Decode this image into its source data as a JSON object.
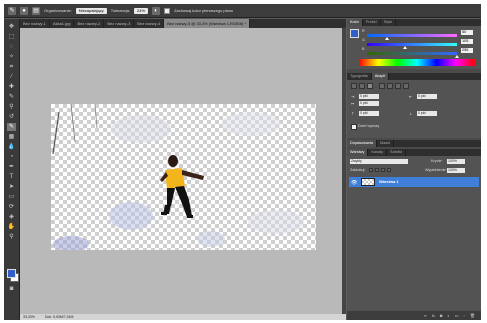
{
  "options": {
    "sample_label": "Organizowanie:",
    "sample_value": "Niezapalający",
    "tolerance_label": "Tolerancja:",
    "tolerance_value": "24%",
    "protect_label": "Zachowaj kolor pierwszego planu"
  },
  "tabs": [
    {
      "label": "Bez nazwy-1"
    },
    {
      "label": "Akka1.jpg"
    },
    {
      "label": "Bez nazwy-2"
    },
    {
      "label": "Bez nazwy-3"
    },
    {
      "label": "Bez nazwy-4"
    },
    {
      "label": "Bez nazwy-5 @ 33,3% (Warstwa 1,RGB/8) *"
    }
  ],
  "status": {
    "zoom": "33,33%",
    "doc": "Dok: 5,93M/7,91M"
  },
  "color_panel": {
    "tabs": [
      "Kolor",
      "Próbki",
      "Style"
    ],
    "channels": [
      {
        "label": "R",
        "value": "50",
        "pos": 0.2
      },
      {
        "label": "G",
        "value": "105",
        "pos": 0.41
      },
      {
        "label": "B",
        "value": "255",
        "pos": 1.0
      }
    ]
  },
  "type_panel": {
    "tabs": [
      "Typografia",
      "Akapit"
    ],
    "indent_left": "0 pkt",
    "indent_right": "0 pkt",
    "first_line": "0 pkt",
    "space_before": "0 pkt",
    "space_after": "0 pkt",
    "hyphenate_label": "Dziel wyrazy"
  },
  "layers_panel": {
    "tabs": [
      "Dopasowania",
      "Maski"
    ],
    "subtabs": [
      "Warstwy",
      "Kanały",
      "Ścieżki"
    ],
    "blend_mode": "Zwykły",
    "opacity_label": "Krycie:",
    "opacity_value": "100%",
    "lock_label": "Zablokuj:",
    "fill_label": "Wypełnienie:",
    "fill_value": "100%",
    "layer_name": "Warstwa 1"
  },
  "colors": {
    "foreground": "#2f5fc7",
    "highlight": "#3f7fd8",
    "shirt": "#f2b51c"
  }
}
